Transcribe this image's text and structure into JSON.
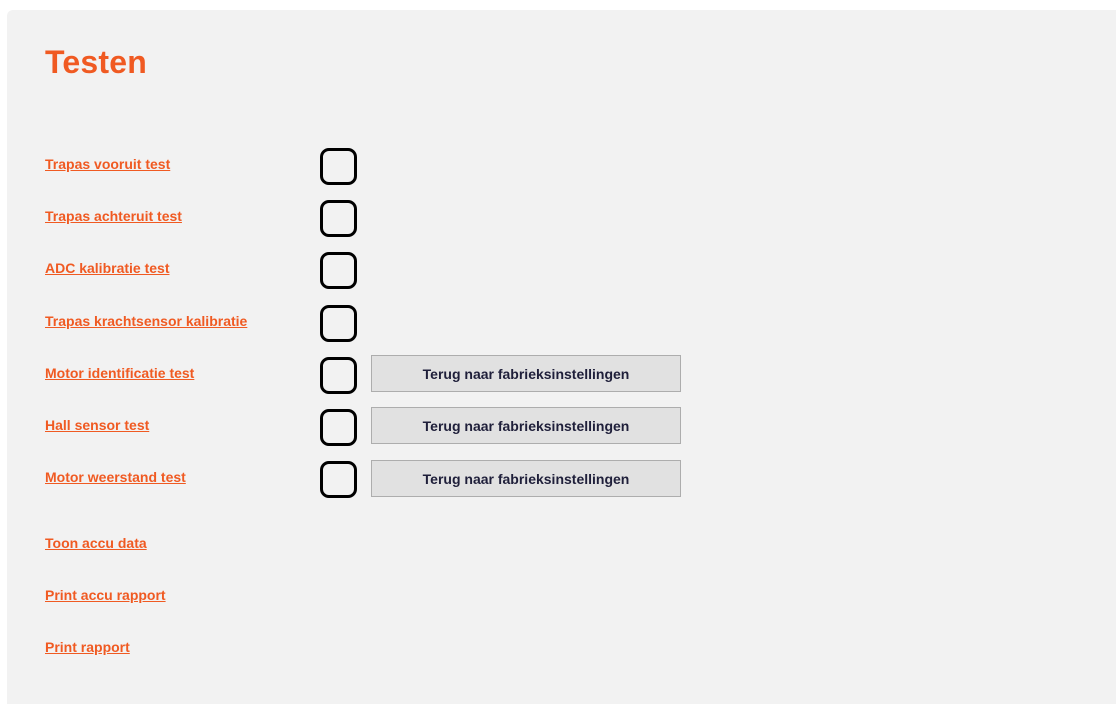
{
  "page": {
    "title": "Testen"
  },
  "tests": [
    {
      "label": "Trapas vooruit test",
      "checked": false
    },
    {
      "label": "Trapas achteruit test",
      "checked": false
    },
    {
      "label": "ADC kalibratie test",
      "checked": false
    },
    {
      "label": "Trapas krachtsensor kalibratie",
      "checked": false
    },
    {
      "label": "Motor identificatie test",
      "checked": false,
      "button": "Terug naar fabrieksinstellingen"
    },
    {
      "label": "Hall sensor test",
      "checked": false,
      "button": "Terug naar fabrieksinstellingen"
    },
    {
      "label": "Motor weerstand test",
      "checked": false,
      "button": "Terug naar fabrieksinstellingen"
    }
  ],
  "actions": [
    {
      "label": "Toon accu data"
    },
    {
      "label": "Print accu rapport"
    },
    {
      "label": "Print rapport"
    }
  ],
  "colors": {
    "accent": "#f05a22",
    "panel_background": "#f2f2f2",
    "button_background": "#e1e1e1",
    "button_text": "#1f1f3a"
  }
}
